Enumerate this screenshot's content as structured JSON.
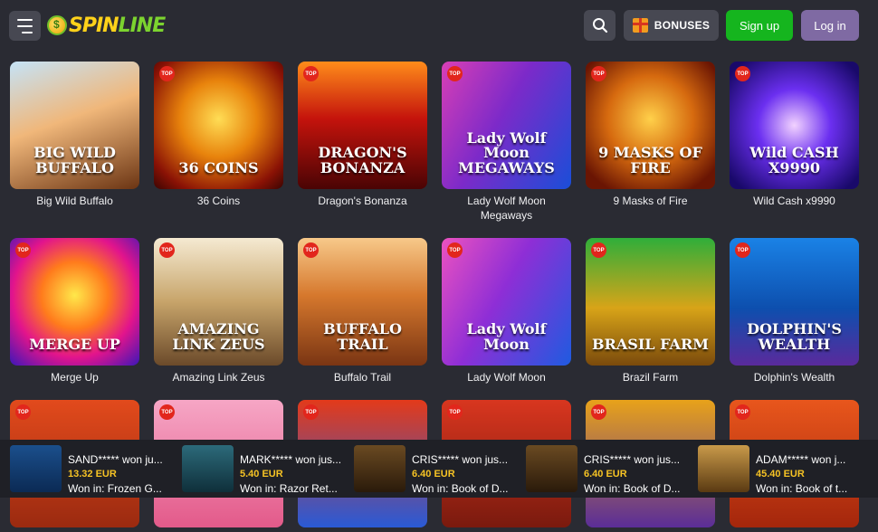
{
  "header": {
    "logo_a": "SPIN",
    "logo_b": "LINE",
    "bonuses_label": "BONUSES",
    "signup_label": "Sign up",
    "login_label": "Log in"
  },
  "badge_text": "TOP",
  "games": [
    {
      "tile": "BIG WILD BUFFALO",
      "label": "Big Wild Buffalo",
      "bg": "linear-gradient(160deg,#c5e3f7 0%,#f0b77a 45%,#6b3413 100%)"
    },
    {
      "tile": "36 COINS",
      "label": "36 Coins",
      "bg": "radial-gradient(circle at 50% 45%,#ffdd55 0%,#e8830c 40%,#8a1205 80%,#3b0502 100%)"
    },
    {
      "tile": "DRAGON'S BONANZA",
      "label": "Dragon's Bonanza",
      "bg": "linear-gradient(180deg,#ff8c1a 0%,#c4130c 45%,#4a0404 100%)"
    },
    {
      "tile": "Lady Wolf Moon MEGAWAYS",
      "label": "Lady Wolf Moon\nMegaways",
      "bg": "linear-gradient(120deg,#d93fb5 0%,#7c2ac9 45%,#1a4ed8 100%)"
    },
    {
      "tile": "9 MASKS OF FIRE",
      "label": "9 Masks of Fire",
      "bg": "radial-gradient(circle at 50% 45%,#ffd04a 0%,#d66a0f 45%,#6a1503 85%)"
    },
    {
      "tile": "Wild CASH X9990",
      "label": "Wild Cash x9990",
      "bg": "radial-gradient(circle at 50% 50%,#f2d2ff 0%,#6b2ff0 40%,#19096a 90%)"
    },
    {
      "tile": "MERGE UP",
      "label": "Merge Up",
      "bg": "radial-gradient(circle at 50% 45%,#ffe84a 0%,#ff7b1c 35%,#e2148c 65%,#3b16b8 100%)"
    },
    {
      "tile": "AMAZING LINK ZEUS",
      "label": "Amazing Link Zeus",
      "bg": "linear-gradient(180deg,#f5ead2 0%,#c7a46a 50%,#6b4a2a 100%)"
    },
    {
      "tile": "BUFFALO TRAIL",
      "label": "Buffalo Trail",
      "bg": "linear-gradient(180deg,#f7c98a 0%,#d6782d 45%,#7a3513 100%)"
    },
    {
      "tile": "Lady Wolf Moon",
      "label": "Lady Wolf Moon",
      "bg": "linear-gradient(120deg,#ec52c0 0%,#8e2ed6 45%,#1f5be0 100%)"
    },
    {
      "tile": "BRASIL FARM",
      "label": "Brazil Farm",
      "bg": "linear-gradient(180deg,#2fae3a 0%,#d8a418 55%,#7a4a0c 100%)"
    },
    {
      "tile": "DOLPHIN'S WEALTH",
      "label": "Dolphin's Wealth",
      "bg": "linear-gradient(180deg,#1a82e6 0%,#0d4fae 55%,#5a2a9c 100%)"
    },
    {
      "tile": "",
      "label": "",
      "bg": "linear-gradient(180deg,#e24a1c 0%,#9b2a10 100%)"
    },
    {
      "tile": "",
      "label": "",
      "bg": "linear-gradient(180deg,#f6a6c5 0%,#e35a8a 100%)"
    },
    {
      "tile": "",
      "label": "",
      "bg": "linear-gradient(180deg,#e33a1a 0%,#2a5ad6 100%)"
    },
    {
      "tile": "",
      "label": "",
      "bg": "linear-gradient(180deg,#d8361f 0%,#7a1a0e 100%)"
    },
    {
      "tile": "",
      "label": "",
      "bg": "linear-gradient(180deg,#e8a21a 0%,#5b2d98 100%)"
    },
    {
      "tile": "",
      "label": "",
      "bg": "linear-gradient(180deg,#e8561c 0%,#a4260c 100%)"
    }
  ],
  "wins": [
    {
      "user": "SAND***** won ju...",
      "amount": "13.32 EUR",
      "game": "Won in: Frozen G...",
      "bg": "linear-gradient(180deg,#1b4f8c 0%,#0b2a54 100%)"
    },
    {
      "user": "MARK***** won jus...",
      "amount": "5.40 EUR",
      "game": "Won in: Razor Ret...",
      "bg": "linear-gradient(180deg,#2c6a7a 0%,#0f2f3a 100%)"
    },
    {
      "user": "CRIS***** won jus...",
      "amount": "6.40 EUR",
      "game": "Won in: Book of D...",
      "bg": "linear-gradient(180deg,#6a4a22 0%,#2a1a0a 100%)"
    },
    {
      "user": "CRIS***** won jus...",
      "amount": "6.40 EUR",
      "game": "Won in: Book of D...",
      "bg": "linear-gradient(180deg,#6a4a22 0%,#2a1a0a 100%)"
    },
    {
      "user": "ADAM***** won j...",
      "amount": "45.40 EUR",
      "game": "Won in: Book of t...",
      "bg": "linear-gradient(180deg,#c99a4a 0%,#5a3a12 100%)"
    }
  ]
}
